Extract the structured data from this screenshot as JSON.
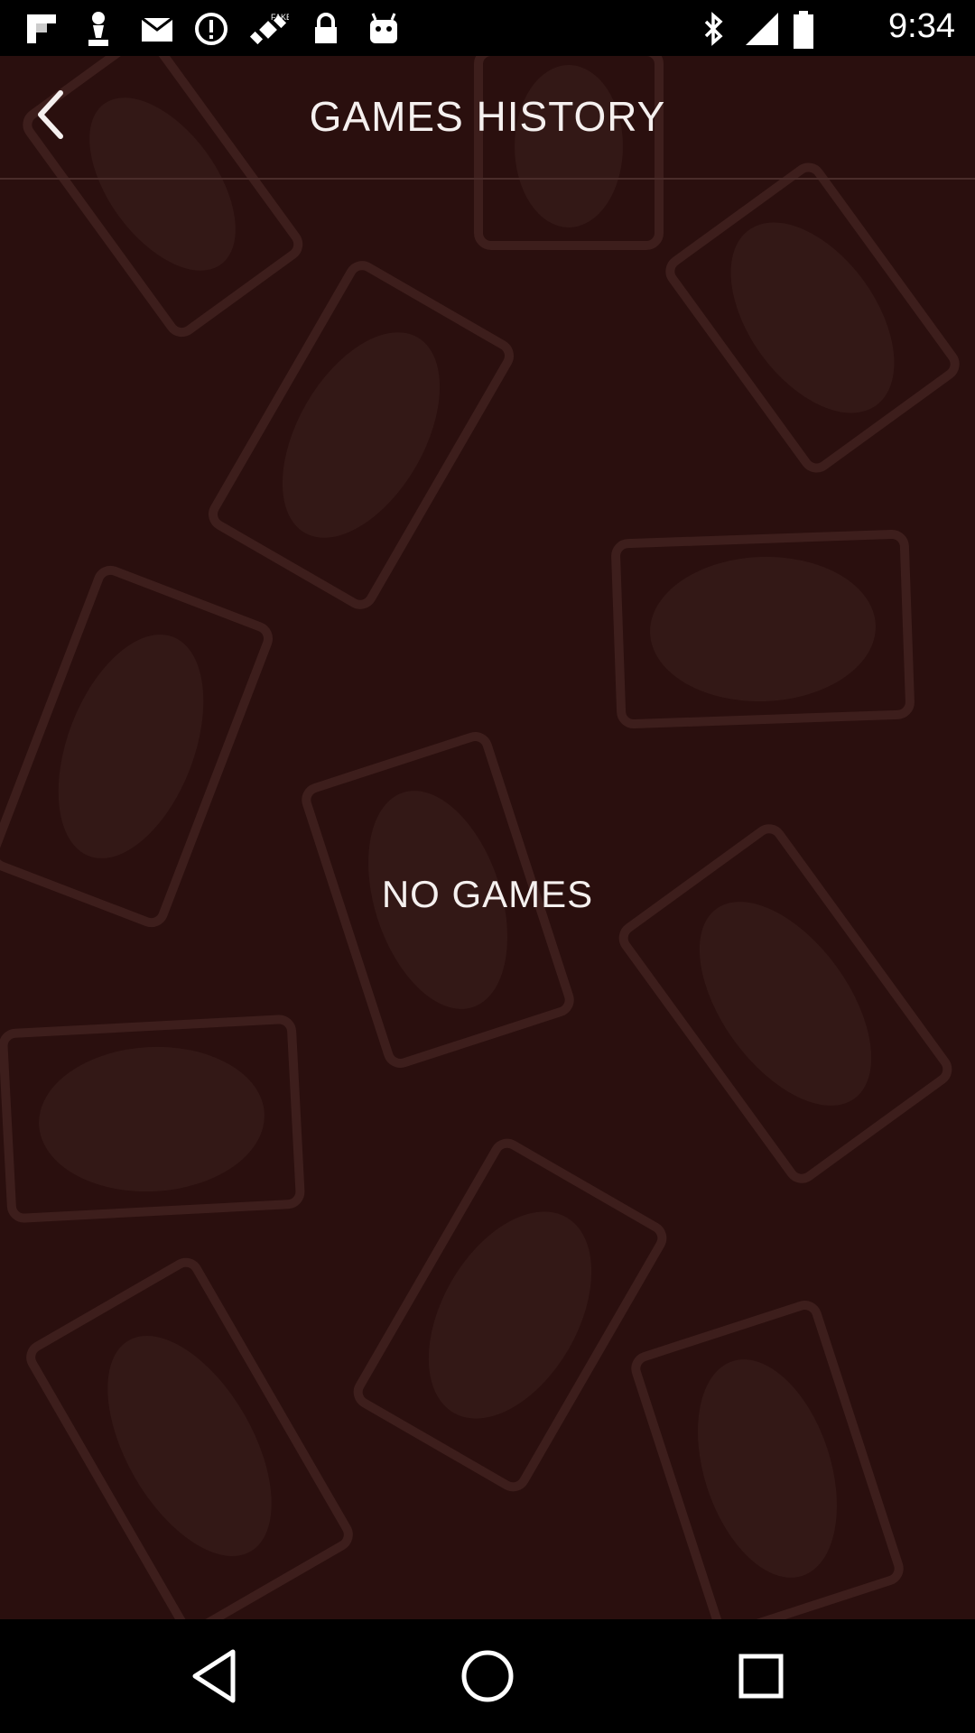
{
  "status_bar": {
    "time": "9:34",
    "left_icons": [
      "flipboard-icon",
      "chess-pawn-icon",
      "mail-icon",
      "info-icon",
      "satellite-icon",
      "lock-icon",
      "android-icon"
    ],
    "right_icons": [
      "bluetooth-icon",
      "signal-icon",
      "battery-icon"
    ]
  },
  "header": {
    "title": "GAMES HISTORY",
    "back_icon": "chevron-left-icon"
  },
  "main": {
    "empty_message": "NO GAMES"
  },
  "nav_bar": {
    "buttons": [
      "back-triangle-icon",
      "home-circle-icon",
      "recents-square-icon"
    ]
  },
  "colors": {
    "background": "#2a0f0e",
    "card_outline": "#3d1e1c",
    "text": "#f5f0ef"
  }
}
